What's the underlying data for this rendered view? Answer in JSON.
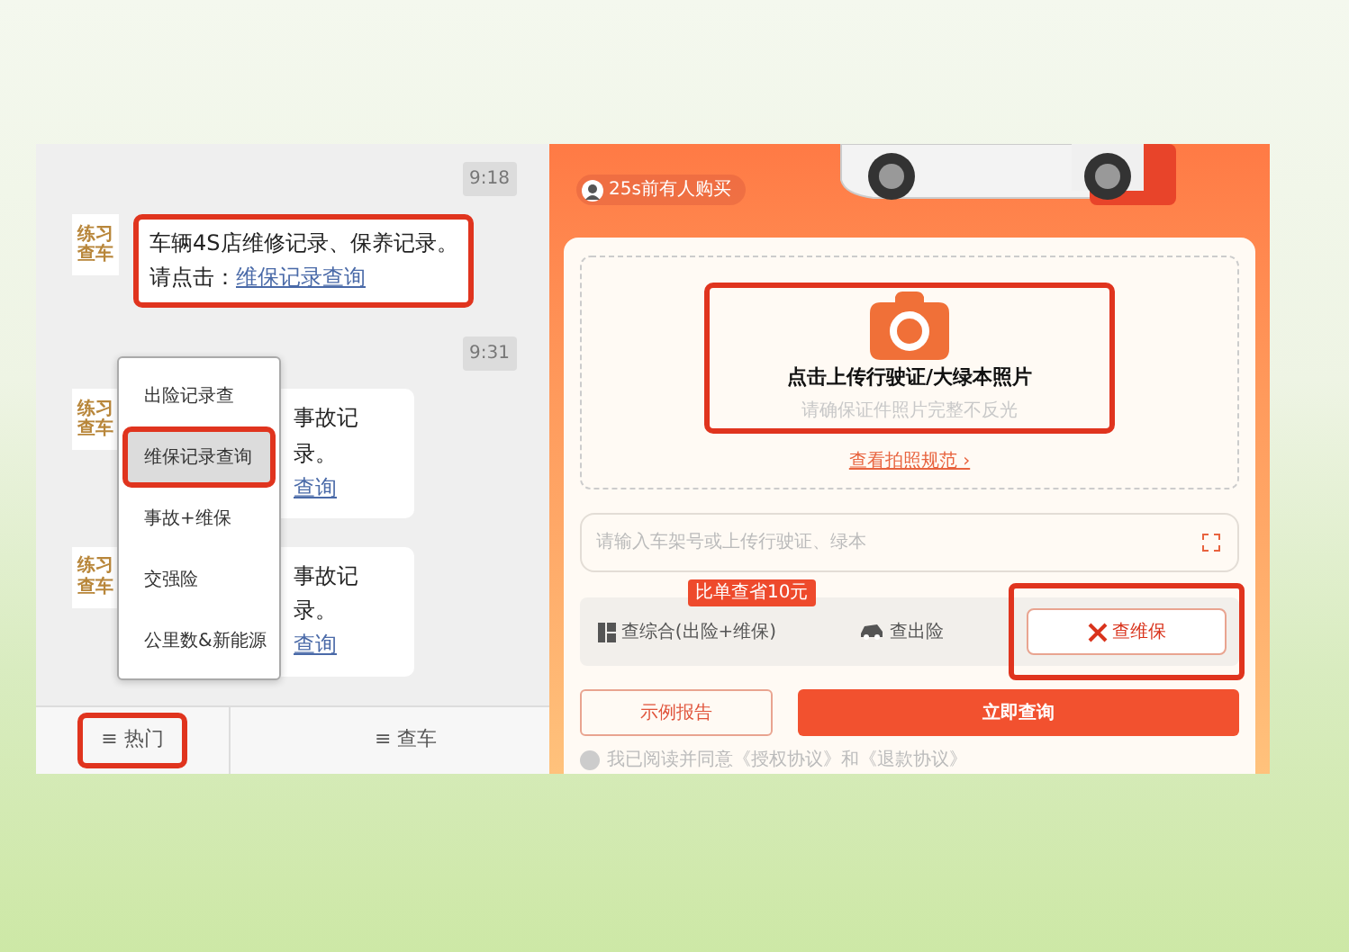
{
  "chat": {
    "messages": [
      {
        "time": "9:18",
        "avatar": "练习查车",
        "line1": "车辆4S店维修记录、保养记录。",
        "prompt": "请点击：",
        "link": "维保记录查询",
        "highlighted": true
      },
      {
        "time": "9:31",
        "avatar": "练习查车",
        "line1": "事故记录。",
        "link": "查询",
        "highlighted": false
      },
      {
        "avatar": "练习查车",
        "line1": "事故记录。",
        "link": "查询",
        "highlighted": false
      }
    ],
    "menu": [
      {
        "label": "出险记录查",
        "selected": false,
        "highlighted": false
      },
      {
        "label": "维保记录查询",
        "selected": true,
        "highlighted": true
      },
      {
        "label": "事故+维保",
        "selected": false,
        "highlighted": false
      },
      {
        "label": "交强险",
        "selected": false,
        "highlighted": false
      },
      {
        "label": "公里数&新能源",
        "selected": false,
        "highlighted": false
      }
    ],
    "tabs": [
      {
        "icon": "≡",
        "label": "热门",
        "highlighted": true
      },
      {
        "icon": "≡",
        "label": "查车",
        "highlighted": false
      }
    ]
  },
  "query": {
    "recent_buyer": "25s前有人购买",
    "upload": {
      "title": "点击上传行驶证/大绿本照片",
      "hint": "请确保证件照片完整不反光",
      "highlighted": true,
      "link": "查看拍照规范 ›"
    },
    "vin_field": {
      "placeholder": "请输入车架号或上传行驶证、绿本"
    },
    "options": [
      {
        "kind": "combo",
        "label": "查综合(出险+维保)",
        "badge": "比单查省10元",
        "selected": false,
        "highlighted": false
      },
      {
        "kind": "claims",
        "label": "查出险",
        "selected": false,
        "highlighted": false
      },
      {
        "kind": "maintenance",
        "label": "查维保",
        "selected": true,
        "highlighted": true
      }
    ],
    "sample_button": "示例报告",
    "submit_button": "立即查询",
    "agreement": {
      "text": "我已阅读并同意《授权协议》和《退款协议》",
      "checked": false
    }
  }
}
